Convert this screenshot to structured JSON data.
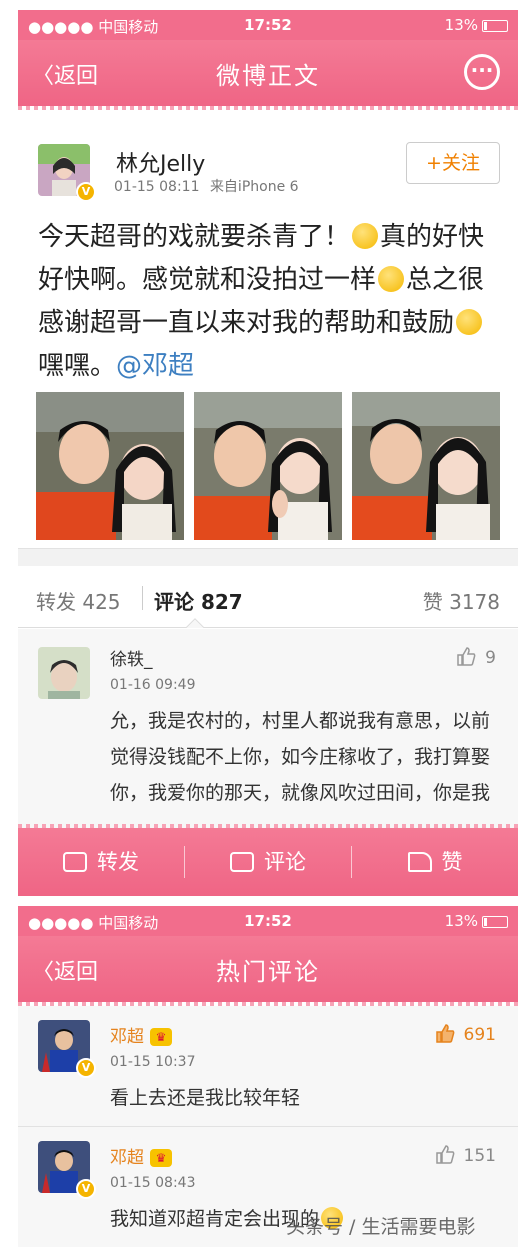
{
  "status_bar": {
    "carrier": "●●●●● 中国移动",
    "time": "17:52",
    "battery": "13%"
  },
  "nav": {
    "back_label": "返回",
    "title": "微博正文",
    "more_label": "···"
  },
  "post": {
    "author": "林允Jelly",
    "time": "01-15 08:11",
    "source": "来自iPhone 6",
    "follow_label": "+关注",
    "verified_badge": "V",
    "text_1": "今天超哥的戏就要杀青了！",
    "text_2": "真的好快好快啊。感觉就和没拍过一样",
    "text_3": "总之很感谢超哥一直以来对我的帮助和鼓励",
    "text_4": "嘿嘿。",
    "mention": "@邓超"
  },
  "tabs": {
    "repost": "转发 425",
    "comment": "评论 827",
    "like": "赞 3178"
  },
  "comment_1": {
    "name": "徐轶_",
    "time": "01-16 09:49",
    "likes": "9",
    "text": "允，我是农村的，村里人都说我有意思，以前觉得没钱配不上你，如今庄稼收了，我打算娶你，我爱你的那天，就像风吹过田间，你是我的初恋"
  },
  "actions": {
    "repost": "转发",
    "comment": "评论",
    "like": "赞"
  },
  "status_bar_2": {
    "carrier": "●●●●● 中国移动",
    "time": "17:52",
    "battery": "13%"
  },
  "nav_2": {
    "back_label": "返回",
    "title": "热门评论"
  },
  "hot_1": {
    "name": "邓超",
    "time": "01-15 10:37",
    "likes": "691",
    "text": "看上去还是我比较年轻",
    "crown": "♛"
  },
  "hot_2": {
    "name": "邓超",
    "time": "01-15 08:43",
    "likes": "151",
    "text": "我知道邓超肯定会出现的",
    "crown": "♛"
  },
  "watermark": "头条号 / 生活需要电影",
  "colors": {
    "header_pink": "#ef6585",
    "accent_orange": "#e5831d",
    "link_blue": "#3d7fc1"
  }
}
